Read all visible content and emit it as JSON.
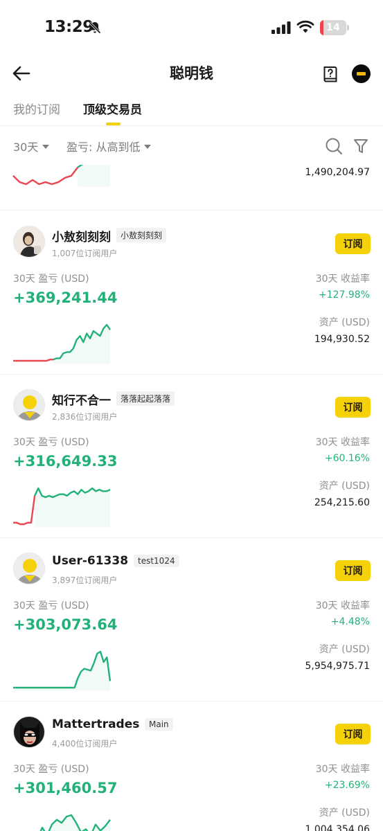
{
  "status_bar": {
    "time": "13:29",
    "battery_level": "14",
    "battery_fraction": 0.14,
    "icons": [
      "bell-slash-icon",
      "signal-icon",
      "wifi-icon",
      "battery-icon"
    ]
  },
  "nav": {
    "title": "聪明钱",
    "icons": [
      "back-arrow-icon",
      "guide-book-icon",
      "profile-avatar-icon"
    ]
  },
  "tabs": [
    {
      "label": "我的订阅",
      "active": false
    },
    {
      "label": "顶级交易员",
      "active": true
    }
  ],
  "filters": {
    "period": "30天",
    "sort": "盈亏: 从高到低",
    "icons": [
      "search-icon",
      "filter-icon"
    ]
  },
  "colors": {
    "accent": "#f5d10a",
    "profit": "#22b279",
    "loss": "#e9464f"
  },
  "partial_trader": {
    "assets_value": "1,490,204.97",
    "chart": {
      "values": [
        34,
        31,
        30,
        32,
        30,
        31,
        30,
        31,
        33,
        34,
        38,
        40,
        44,
        45,
        47,
        46
      ],
      "loss_points": 10
    }
  },
  "traders": [
    {
      "name": "小敖刻刻刻",
      "tag": "小敖刻刻刻",
      "subscribers": "1,007位订阅用户",
      "subscribe_label": "订阅",
      "pnl_label": "30天 盈亏 (USD)",
      "pnl_value": "+369,241.44",
      "roi_label": "30天 收益率",
      "roi_value": "+127.98%",
      "assets_label": "资产 (USD)",
      "assets_value": "194,930.52",
      "avatar": "photo-avatar",
      "chart": {
        "values": [
          10,
          10,
          10,
          10,
          10,
          10,
          10,
          10,
          10,
          10,
          10,
          11,
          11,
          12,
          12,
          16,
          17,
          17,
          20,
          27,
          30,
          25,
          32,
          28,
          34,
          32,
          30,
          36,
          39,
          35
        ],
        "loss_points": 12
      }
    },
    {
      "name": "知行不合一",
      "tag": "落落起起落落",
      "subscribers": "2,836位订阅用户",
      "subscribe_label": "订阅",
      "pnl_label": "30天 盈亏 (USD)",
      "pnl_value": "+316,649.33",
      "roi_label": "30天 收益率",
      "roi_value": "+60.16%",
      "assets_label": "资产 (USD)",
      "assets_value": "254,215.60",
      "avatar": "default-avatar",
      "chart": {
        "values": [
          10,
          10,
          9,
          9,
          10,
          10,
          28,
          33,
          28,
          27,
          28,
          27,
          28,
          29,
          29,
          28,
          30,
          31,
          29,
          32,
          30,
          31,
          33,
          31,
          32,
          31,
          31,
          32
        ],
        "loss_points": 6
      }
    },
    {
      "name": "User-61338",
      "tag": "test1024",
      "subscribers": "3,897位订阅用户",
      "subscribe_label": "订阅",
      "pnl_label": "30天 盈亏 (USD)",
      "pnl_value": "+303,073.64",
      "roi_label": "30天 收益率",
      "roi_value": "+4.48%",
      "assets_label": "资产 (USD)",
      "assets_value": "5,954,975.71",
      "avatar": "default-avatar",
      "chart": {
        "values": [
          10,
          10,
          10,
          10,
          10,
          10,
          10,
          10,
          10,
          10,
          10,
          10,
          10,
          10,
          10,
          10,
          10,
          10,
          10,
          10,
          20,
          27,
          30,
          29,
          28,
          36,
          46,
          48,
          37,
          42,
          17
        ],
        "loss_points": 0
      }
    },
    {
      "name": "Mattertrades",
      "tag": "Main",
      "subscribers": "4,400位订阅用户",
      "subscribe_label": "订阅",
      "pnl_label": "30天 盈亏 (USD)",
      "pnl_value": "+301,460.57",
      "roi_label": "30天 收益率",
      "roi_value": "+23.69%",
      "assets_label": "资产 (USD)",
      "assets_value": "1,004,354.06",
      "avatar": "masked-avatar",
      "chart": {
        "values": [
          10,
          10,
          11,
          10,
          12,
          18,
          25,
          20,
          27,
          30,
          28,
          32,
          33,
          28,
          22,
          24,
          20,
          27,
          23,
          26,
          30
        ],
        "loss_points": 3
      }
    }
  ]
}
